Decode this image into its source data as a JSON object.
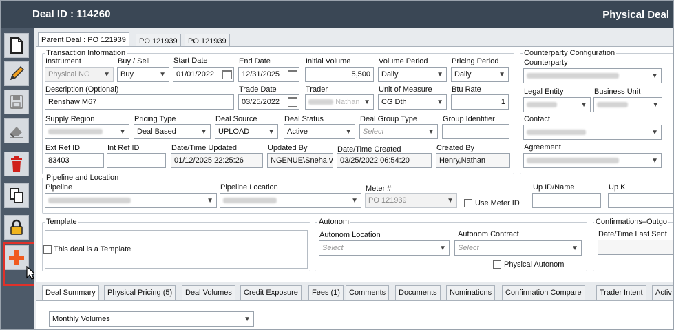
{
  "window": {
    "deal_id": "Deal ID : 114260",
    "title": "Physical Deal"
  },
  "tabs": [
    "Parent Deal : PO 121939",
    "PO 121939",
    "PO 121939"
  ],
  "transaction": {
    "group_title": "Transaction Information",
    "instrument": {
      "label": "Instrument",
      "value": "Physical NG"
    },
    "buy_sell": {
      "label": "Buy / Sell",
      "value": "Buy"
    },
    "start_date": {
      "label": "Start Date",
      "value": "01/01/2022"
    },
    "end_date": {
      "label": "End Date",
      "value": "12/31/2025"
    },
    "initial_volume": {
      "label": "Initial Volume",
      "value": "5,500"
    },
    "volume_period": {
      "label": "Volume Period",
      "value": "Daily"
    },
    "pricing_period": {
      "label": "Pricing Period",
      "value": "Daily"
    },
    "description": {
      "label": "Description (Optional)",
      "value": "Renshaw M67"
    },
    "trade_date": {
      "label": "Trade Date",
      "value": "03/25/2022"
    },
    "trader": {
      "label": "Trader",
      "value": "Nathan"
    },
    "unit_of_measure": {
      "label": "Unit of Measure",
      "value": "CG Dth"
    },
    "btu_rate": {
      "label": "Btu Rate",
      "value": "1"
    },
    "supply_region": {
      "label": "Supply Region"
    },
    "pricing_type": {
      "label": "Pricing Type",
      "value": "Deal Based"
    },
    "deal_source": {
      "label": "Deal Source",
      "value": "UPLOAD"
    },
    "deal_status": {
      "label": "Deal Status",
      "value": "Active"
    },
    "deal_group_type": {
      "label": "Deal Group Type",
      "placeholder": "Select"
    },
    "group_identifier": {
      "label": "Group Identifier"
    },
    "ext_ref_id": {
      "label": "Ext Ref ID",
      "value": "83403"
    },
    "int_ref_id": {
      "label": "Int Ref ID"
    },
    "dt_updated": {
      "label": "Date/Time Updated",
      "value": "01/12/2025 22:25:26"
    },
    "updated_by": {
      "label": "Updated By",
      "value": "NGENUE\\Sneha.v"
    },
    "dt_created": {
      "label": "Date/Time Created",
      "value": "03/25/2022 06:54:20"
    },
    "created_by": {
      "label": "Created By",
      "value": "Henry,Nathan"
    }
  },
  "counterparty": {
    "group_title": "Counterparty Configuration",
    "counterparty_label": "Counterparty",
    "legal_entity_label": "Legal Entity",
    "business_unit_label": "Business Unit",
    "contact_label": "Contact",
    "agreement_label": "Agreement"
  },
  "pipeline": {
    "group_title": "Pipeline and Location",
    "pipeline_label": "Pipeline",
    "location_label": "Pipeline Location",
    "meter_label": "Meter #",
    "meter_value": "PO 121939",
    "use_meter_label": "Use Meter ID",
    "up_id_label": "Up ID/Name",
    "up_k_label": "Up K"
  },
  "template": {
    "group_title": "Template",
    "checkbox_label": "This deal is a Template"
  },
  "autonom": {
    "group_title": "Autonom",
    "location_label": "Autonom Location",
    "contract_label": "Autonom Contract",
    "select_placeholder": "Select",
    "physical_label": "Physical Autonom"
  },
  "confirmations": {
    "group_title": "Confirmations–Outgo",
    "last_sent_label": "Date/Time Last Sent"
  },
  "bottom_tabs": [
    "Deal Summary",
    "Physical Pricing (5)",
    "Deal Volumes",
    "Credit Exposure",
    "Fees (1)",
    "Comments",
    "Documents",
    "Nominations",
    "Confirmation Compare",
    "Trader Intent",
    "Activ"
  ],
  "summary": {
    "select_value": "Monthly Volumes"
  },
  "colors": {
    "titlebar": "#3a4755",
    "sidebar": "#4d5a69",
    "highlight": "#e0312a",
    "add_icon": "#f05a1e"
  }
}
